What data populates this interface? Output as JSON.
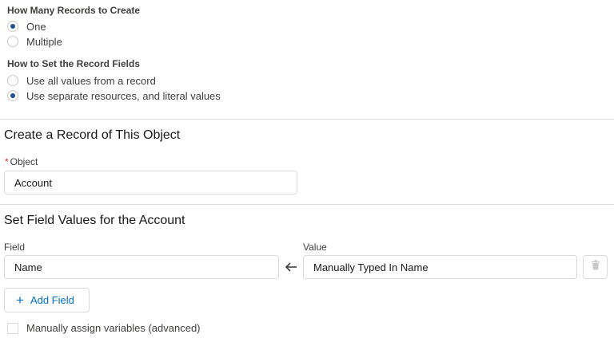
{
  "records_group": {
    "title": "How Many Records to Create",
    "options": [
      {
        "label": "One",
        "checked": true
      },
      {
        "label": "Multiple",
        "checked": false
      }
    ]
  },
  "fields_group": {
    "title": "How to Set the Record Fields",
    "options": [
      {
        "label": "Use all values from a record",
        "checked": false
      },
      {
        "label": "Use separate resources, and literal values",
        "checked": true
      }
    ]
  },
  "object_section": {
    "title": "Create a Record of This Object",
    "required_marker": "*",
    "object_label": "Object",
    "object_value": "Account"
  },
  "field_values_section": {
    "title": "Set Field Values for the Account",
    "field_header": "Field",
    "value_header": "Value",
    "row": {
      "field": "Name",
      "arrow_icon": "left-arrow-icon",
      "value": "Manually Typed In Name",
      "delete_icon": "trash-icon"
    },
    "add_field_label": "Add Field"
  },
  "manual_assign": {
    "label": "Manually assign variables (advanced)",
    "checked": false
  },
  "colors": {
    "accent": "#0070d2",
    "radio_fill": "#1b5297",
    "border": "#dddbda",
    "required": "#c23934"
  }
}
